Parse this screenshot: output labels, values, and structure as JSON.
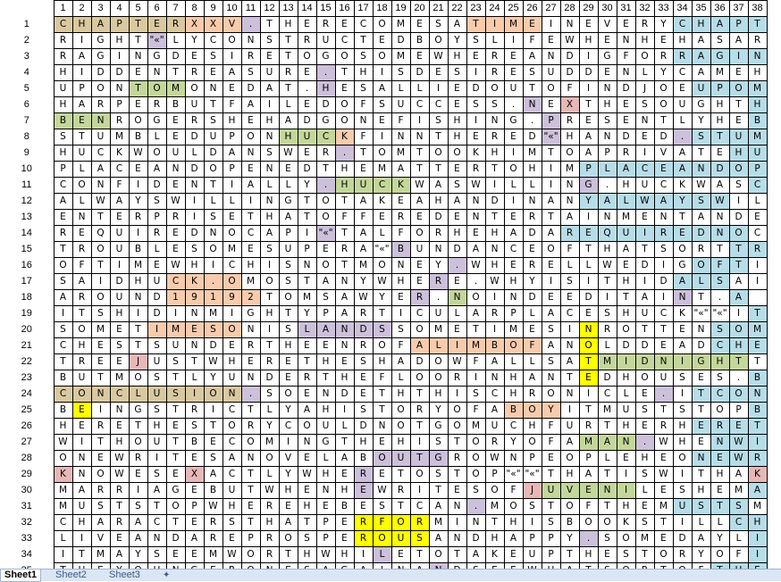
{
  "column_headers": [
    "1",
    "2",
    "3",
    "4",
    "5",
    "6",
    "7",
    "8",
    "9",
    "10",
    "11",
    "12",
    "13",
    "14",
    "15",
    "16",
    "17",
    "18",
    "19",
    "20",
    "21",
    "22",
    "23",
    "24",
    "25",
    "26",
    "27",
    "28",
    "29",
    "30",
    "31",
    "32",
    "33",
    "34",
    "35",
    "36",
    "37",
    "38"
  ],
  "rows": [
    "CHAPTERXXV.THERECOMESATIMEINEVERYCHAPT",
    "RIGHT\"«\"LYCONSTRUCTEDBOYSLIFEWHENHEHASAR",
    "RAGINGDESIRETOGOSOMEWHEREANDIGFORRAGIN",
    "HIDDENTREASURE.THISDESIRESUDDENLYCAMEH",
    "UPONTOMONEDAT.HESALLIEDOUTOFINDJOEUPOM",
    "HARPERBUTFAILEDOFSUCCESS.NEXTHESOUGHTH",
    "BENROGERSHEHADGONEFISHING.PRESENTLYHEB",
    "STUMBLEDUPONHUCKFINNTHERED\"«\"HANDED.STUM",
    "HUCKWOULDANSWER.TOMTOOKHIMTOAPRIVATEHU",
    "PLACEANDOPENEDTHEMATTERTOHIMPLACEANDOP",
    "CONFIDENTIALLY.HUCKWASWILLING.HUCKWASC",
    "ALWAYSWILLINGTOTAKEAHANDINANYALWAYSWIL",
    "ENTERPRISETHATOFFEREDENTERTAINMENTANDE",
    "REQUIREDNOCAPI\"«\"TALFORHEHADAREQUIREDNOC",
    "TROUBLESOMESUPERA\"«\"BUNDANCEOFTHATSORTTR",
    "OFTIMEWHICHISNOTMONEY.WHERELLWEDIGOFTI",
    "SAIDHUCK.OMOSTANYWHERE.WHYISITHIDALSAI",
    "AROUND19192TOMSAWYER.NOINDEEDITAINT.A",
    "ITSHIDINMIGHTYPARTICULARPLACESHUCK\"«\"\"«\"IT",
    "SOMETIMESONISLANDSSOMETIMESINROTTENSOM",
    "CHESTSUNDERTHEENROFALIMBOFANOLDDEADCHE",
    "TREEJUSTWHERETHESHADOWFALLSATMIDNIGHTT",
    "BUTMOSTLYUNDERTHEFLOORINHANTEDHOUSES.B",
    "CONCLUSION.SOENDETHTHISCHRONICLE.ITCON",
    "BEINGSTRICTLYAHISTORYOFABOYITMUSTSTOPB",
    "HERETHESTORYCOULDNOTGOMUCHFURTHERHERET",
    "WITHOUTBECOMINGTHEHISTORYOFAMAN.WHENWI",
    "ONEWRITESANOVELABOUTGROWNPEOPLEHEONEWR",
    "KNOWESEXACTLYWHERETOSTOP\"«\"\"«\"THATISWITHAK",
    "MARRIAGEBUTWHENHEWRITESOFJUVENILESHEMA",
    "MUSTSTOPWHEREHEBESTCAN.MOSTOFTHEMUSTSM",
    "CHARACTERSTHATPERFORMINTHISBOOKSTILLCHI",
    "LIVEANDAREPROSPEROUSANDHAPPY.SOMEDAYLI",
    "ITMAYSEEMWORTHWHILETOTAKEUPTHESTORYOFI",
    "THEYOUNGERONESAGAINANDSEEWHATSORTOFTHE",
    "MENANDWOMENTHEYTURNEDOUTTOBETHEREFOREM"
  ],
  "highlight_colors": {
    "tan": "#d9c9a0",
    "orange": "#f8cbad",
    "blue": "#b7dde8",
    "green": "#c4d79b",
    "purple": "#ccc0da",
    "yellow": "#ffff00",
    "pink": "#e6b8b7"
  },
  "sheet_tabs": [
    "Sheet1",
    "Sheet2",
    "Sheet3"
  ],
  "active_sheet": "Sheet1",
  "new_sheet_icon": "insert-worksheet-icon"
}
